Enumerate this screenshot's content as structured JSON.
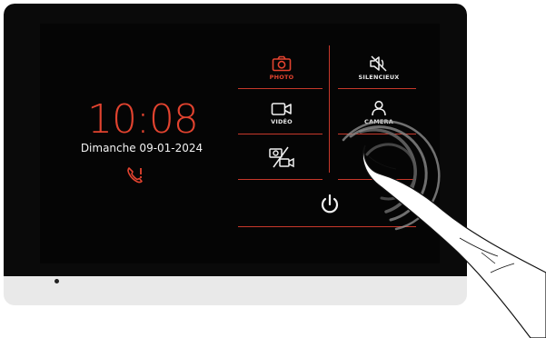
{
  "screen": {
    "time": "10:08",
    "date": "Dimanche  09-01-2024"
  },
  "menu": {
    "photo_label": "PHOTO",
    "video_label": "VIDÉO",
    "silent_label": "SILENCIEUX",
    "camera_label": "CAMERA"
  },
  "icons": {
    "missed_call": "missed-call-icon",
    "photo": "camera-icon",
    "video": "video-camera-icon",
    "photo_video": "photo-video-icon",
    "silent": "muted-speaker-icon",
    "camera": "person-icon",
    "power": "power-icon"
  },
  "colors": {
    "accent": "#e2432f",
    "screen_bg": "#050505",
    "text": "#f2f2f2"
  }
}
